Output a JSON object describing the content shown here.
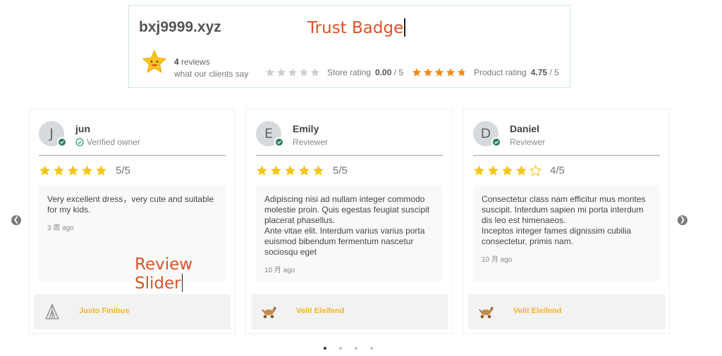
{
  "annotations": {
    "trust_badge": "Trust Badge",
    "review_slider": "Review Slider"
  },
  "badge": {
    "store_name": "bxj9999.xyz",
    "review_count": "4",
    "reviews_word": "reviews",
    "subtitle": "what our clients say",
    "store_rating_label": "Store rating",
    "store_rating_value": "0.00",
    "store_rating_max": "/ 5",
    "store_rating_stars": 0,
    "product_rating_label": "Product rating",
    "product_rating_value": "4.75",
    "product_rating_max": "/ 5",
    "product_rating_stars": 4.75
  },
  "colors": {
    "star": "#f5c518",
    "product_star": "#f28c1a",
    "empty_star": "#cfcfcf",
    "annotation": "#d9532b",
    "product_name": "#f2b52b",
    "verified": "#2e7d5b"
  },
  "reviews": [
    {
      "initial": "J",
      "name": "jun",
      "role": "Verified owner",
      "verified_icon": "check-circle-icon",
      "rating": 5,
      "score": "5/5",
      "text": "Very excellent dress，very cute and suitable for my kids.",
      "date": "3 周 ago",
      "product_icon": "tent-icon",
      "product_name": "Justo Finibus"
    },
    {
      "initial": "E",
      "name": "Emily",
      "role": "Reviewer",
      "rating": 5,
      "score": "5/5",
      "text": "Adipiscing nisi ad nullam integer commodo molestie proin. Quis egestas feugiat suscipit placerat phasellus.\nAnte vitae elit. Interdum varius varius porta euismod bibendum fermentum nascetur sociosqu eget",
      "date": "10 月 ago",
      "product_icon": "toy-horse-icon",
      "product_name": "Velit Eleifend"
    },
    {
      "initial": "D",
      "name": "Daniel",
      "role": "Reviewer",
      "rating": 4,
      "score": "4/5",
      "text": "Consectetur class nam efficitur mus montes suscipit. Interdum sapien mi porta interdum dis leo est himenaeos.\nInceptos integer fames dignissim cubilia consectetur, primis nam.",
      "date": "10 月 ago",
      "product_icon": "toy-horse-icon",
      "product_name": "Velit Eleifend"
    }
  ],
  "pagination": {
    "page_count": 4,
    "active_page": 1
  }
}
